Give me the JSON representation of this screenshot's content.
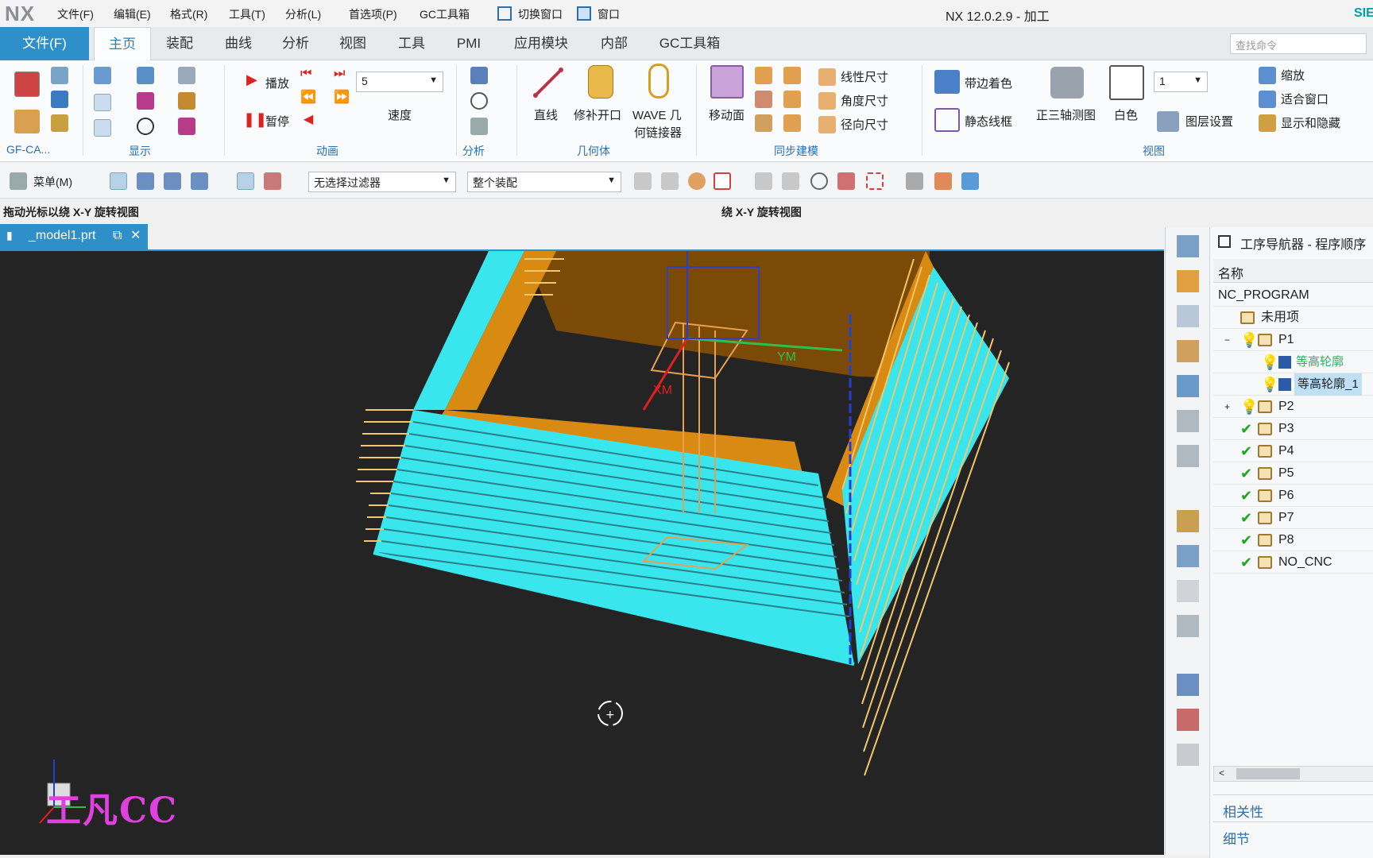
{
  "titlebar": {
    "logo": "NX",
    "menus": [
      "文件(F)",
      "编辑(E)",
      "格式(R)",
      "工具(T)",
      "分析(L)",
      "首选项(P)",
      "GC工具箱"
    ],
    "switch_window": "切换窗口",
    "window_menu": "窗口",
    "title": "NX 12.0.2.9 - 加工",
    "brand": "SIE"
  },
  "tabs": {
    "file": "文件(F)",
    "items": [
      "主页",
      "装配",
      "曲线",
      "分析",
      "视图",
      "工具",
      "PMI",
      "应用模块",
      "内部",
      "GC工具箱"
    ],
    "active": "主页",
    "search_placeholder": "查找命令"
  },
  "ribbon": {
    "groups": {
      "gfca": "GF-CA...",
      "display": "显示",
      "animation": "动画",
      "analysis": "分析",
      "geometry": "几何体",
      "sync": "同步建模",
      "view": "视图"
    },
    "play": "播放",
    "pause": "暂停",
    "speed_label": "速度",
    "speed_value": "5",
    "line": "直线",
    "patch": "修补开口",
    "wave": "WAVE 几",
    "wave2": "何链接器",
    "move_face": "移动面",
    "linear_dim": "线性尺寸",
    "angle_dim": "角度尺寸",
    "radial_dim": "径向尺寸",
    "shaded_edges": "带边着色",
    "static_wire": "静态线框",
    "trimetric": "正三轴测图",
    "white": "白色",
    "layer_value": "1",
    "layer_settings": "图层设置",
    "zoom": "缩放",
    "fit": "适合窗口",
    "show_hide": "显示和隐藏"
  },
  "toolbar2": {
    "menu": "菜单(M)",
    "filter": "无选择过滤器",
    "assembly": "整个装配"
  },
  "cue": {
    "left": "拖动光标以绕 X-Y 旋转视图",
    "center": "绕 X-Y 旋转视图"
  },
  "document": {
    "tab": "_model1.prt"
  },
  "viewport": {
    "axis_ym": "YM",
    "axis_xm": "XM",
    "watermark": "工凡CC",
    "colors": {
      "bg": "#242424",
      "cyan": "#39e6ee",
      "orange": "#d98a12",
      "toolpath": "#f2c66a",
      "pink": "#f0b8c8"
    }
  },
  "navigator": {
    "title": "工序导航器 - 程序顺序",
    "column": "名称",
    "root": "NC_PROGRAM",
    "unused": "未用项",
    "items": [
      {
        "label": "P1",
        "status": "bulb",
        "expanded": true
      },
      {
        "label": "等高轮廓",
        "status": "bulb",
        "child": true
      },
      {
        "label": "等高轮廓_1",
        "status": "bulb",
        "child": true,
        "selected": true
      },
      {
        "label": "P2",
        "status": "bulb"
      },
      {
        "label": "P3",
        "status": "check"
      },
      {
        "label": "P4",
        "status": "check"
      },
      {
        "label": "P5",
        "status": "check"
      },
      {
        "label": "P6",
        "status": "check"
      },
      {
        "label": "P7",
        "status": "check"
      },
      {
        "label": "P8",
        "status": "check"
      },
      {
        "label": "NO_CNC",
        "status": "check"
      }
    ],
    "dependencies": "相关性",
    "details": "细节"
  }
}
